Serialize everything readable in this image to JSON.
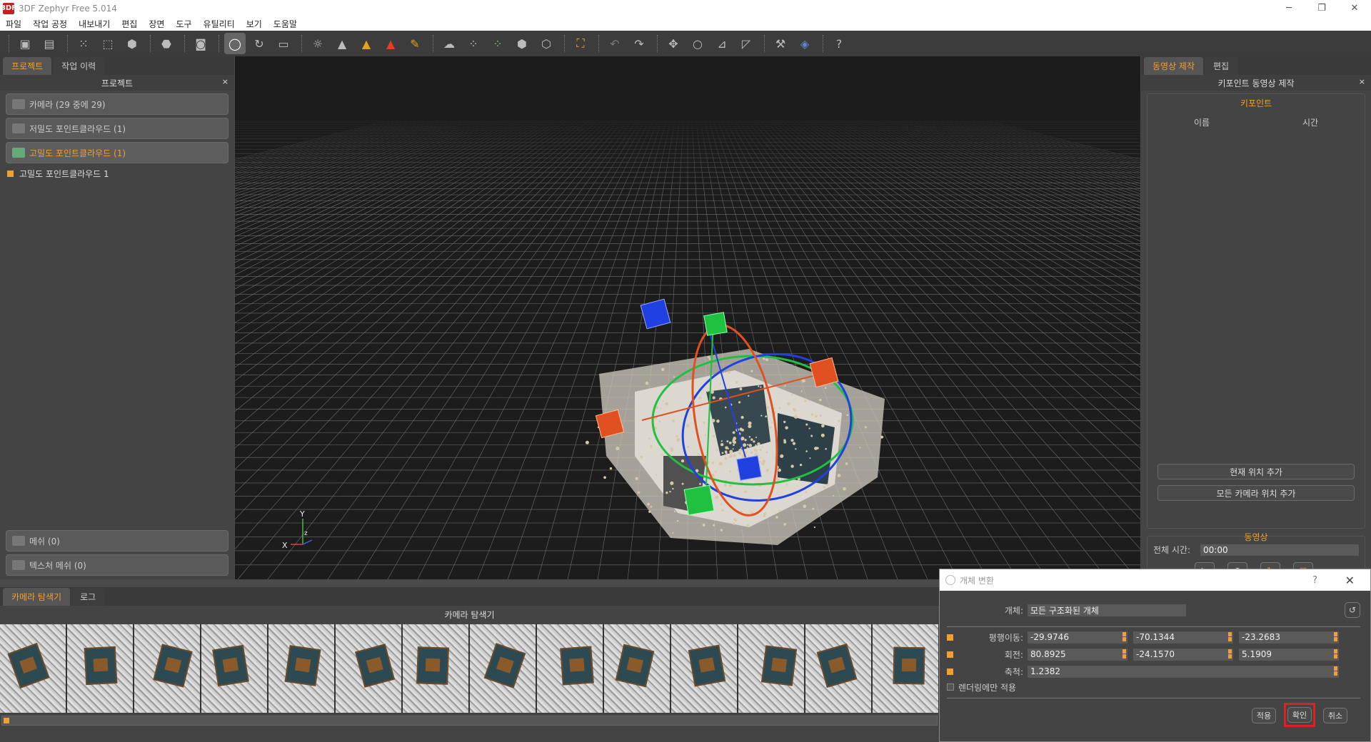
{
  "window": {
    "title": "3DF Zephyr Free 5.014",
    "app_icon": "3DF"
  },
  "menu": [
    "파일",
    "작업 공정",
    "내보내기",
    "편집",
    "장면",
    "도구",
    "유틸리티",
    "보기",
    "도움말"
  ],
  "left": {
    "tabs": [
      "프로젝트",
      "작업 이력"
    ],
    "header": "프로젝트",
    "close": "×",
    "items": {
      "cameras": "카메라 (29 중에 29)",
      "sparse": "저밀도 포인트클라우드 (1)",
      "dense": "고밀도 포인트클라우드 (1)",
      "dense_child": "고밀도 포인트클라우드 1",
      "mesh": "메쉬 (0)",
      "textured": "텍스처 메쉬 (0)"
    }
  },
  "viewport": {
    "axis_y": "Y",
    "axis_z": "z",
    "axis_x": "X"
  },
  "right": {
    "tabs": [
      "동영상 제작",
      "편집"
    ],
    "header": "키포인트 동영상 제작",
    "close": "×",
    "keypoint_section": "키포인트",
    "col_name": "이름",
    "col_time": "시간",
    "add_current": "현재 위치 추가",
    "add_all_cameras": "모든 카메라 위치 추가",
    "video_section": "동영상",
    "total_time_label": "전체 시간:",
    "total_time_value": "00:00"
  },
  "bottom": {
    "tabs": [
      "카메라 탐색기",
      "로그"
    ],
    "header": "카메라 탐색기"
  },
  "dialog": {
    "title": "개체 변환",
    "help": "?",
    "close": "✕",
    "object_label": "개체:",
    "object_value": "모든 구조화된 개체",
    "translate_label": "평행이동:",
    "translate": [
      "-29.9746",
      "-70.1344",
      "-23.2683"
    ],
    "rotate_label": "회전:",
    "rotate": [
      "80.8925",
      "-24.1570",
      "5.1909"
    ],
    "scale_label": "축척:",
    "scale": "1.2382",
    "render_only": "렌더링에만 적용",
    "apply": "적용",
    "ok": "확인",
    "cancel": "취소"
  },
  "colors": {
    "accent": "#f0a030",
    "highlight": "#e02020",
    "gizmo_red": "#e05020",
    "gizmo_green": "#20c040",
    "gizmo_blue": "#2040e0"
  }
}
